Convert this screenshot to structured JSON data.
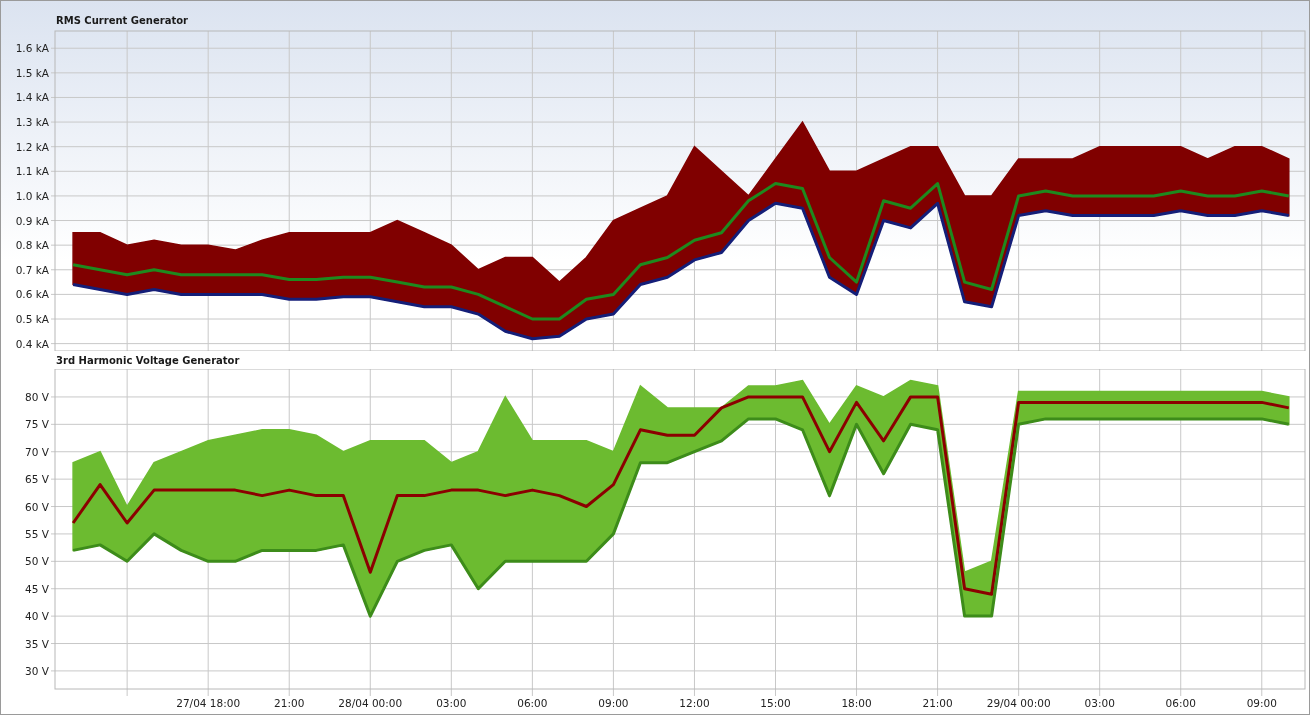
{
  "charts": [
    {
      "title": "RMS Current Generator",
      "chart_data": {
        "type": "line",
        "grid": true,
        "ylim": [
          0.37,
          1.67
        ],
        "yticks": [
          {
            "value": 0.4,
            "label": "0.4 kA"
          },
          {
            "value": 0.5,
            "label": "0.5 kA"
          },
          {
            "value": 0.6,
            "label": "0.6 kA"
          },
          {
            "value": 0.7,
            "label": "0.7 kA"
          },
          {
            "value": 0.8,
            "label": "0.8 kA"
          },
          {
            "value": 0.9,
            "label": "0.9 kA"
          },
          {
            "value": 1.0,
            "label": "1.0 kA"
          },
          {
            "value": 1.1,
            "label": "1.1 kA"
          },
          {
            "value": 1.2,
            "label": "1.2 kA"
          },
          {
            "value": 1.3,
            "label": "1.3 kA"
          },
          {
            "value": 1.4,
            "label": "1.4 kA"
          },
          {
            "value": 1.5,
            "label": "1.5 kA"
          },
          {
            "value": 1.6,
            "label": "1.6 kA"
          }
        ],
        "categories": [
          null,
          null,
          null,
          null,
          null,
          null,
          null,
          null,
          null,
          null,
          null,
          null,
          null,
          null,
          null,
          null,
          null,
          null,
          null,
          null,
          null,
          null,
          null,
          null,
          null,
          null,
          null,
          null,
          null,
          null,
          null,
          null,
          null,
          null,
          null,
          null,
          null,
          null,
          null,
          null,
          null,
          null,
          null,
          null,
          null,
          null
        ],
        "series": [
          {
            "type": "area",
            "color": "#800000",
            "values": [
              0.85,
              0.85,
              0.8,
              0.82,
              0.8,
              0.8,
              0.78,
              0.82,
              0.85,
              0.85,
              0.85,
              0.85,
              0.9,
              0.85,
              0.8,
              0.7,
              0.75,
              0.75,
              0.65,
              0.75,
              0.9,
              0.95,
              1.0,
              1.2,
              1.1,
              1.0,
              1.15,
              1.3,
              1.1,
              1.1,
              1.15,
              1.2,
              1.2,
              1.0,
              1.0,
              1.15,
              1.15,
              1.15,
              1.2,
              1.2,
              1.2,
              1.2,
              1.15,
              1.2,
              1.2,
              1.15
            ]
          },
          {
            "type": "line",
            "color": "#1e8a1e",
            "values": [
              0.72,
              0.7,
              0.68,
              0.7,
              0.68,
              0.68,
              0.68,
              0.68,
              0.66,
              0.66,
              0.67,
              0.67,
              0.65,
              0.63,
              0.63,
              0.6,
              0.55,
              0.5,
              0.5,
              0.58,
              0.6,
              0.72,
              0.75,
              0.82,
              0.85,
              0.98,
              1.05,
              1.03,
              0.75,
              0.65,
              0.98,
              0.95,
              1.05,
              0.65,
              0.62,
              1.0,
              1.02,
              1.0,
              1.0,
              1.0,
              1.0,
              1.02,
              1.0,
              1.0,
              1.02,
              1.0
            ]
          },
          {
            "type": "line",
            "color": "#141e78",
            "values": [
              0.64,
              0.62,
              0.6,
              0.62,
              0.6,
              0.6,
              0.6,
              0.6,
              0.58,
              0.58,
              0.59,
              0.59,
              0.57,
              0.55,
              0.55,
              0.52,
              0.45,
              0.42,
              0.43,
              0.5,
              0.52,
              0.64,
              0.67,
              0.74,
              0.77,
              0.9,
              0.97,
              0.95,
              0.67,
              0.6,
              0.9,
              0.87,
              0.97,
              0.57,
              0.55,
              0.92,
              0.94,
              0.92,
              0.92,
              0.92,
              0.92,
              0.94,
              0.92,
              0.92,
              0.94,
              0.92
            ]
          }
        ]
      }
    },
    {
      "title": "3rd Harmonic Voltage Generator",
      "chart_data": {
        "type": "line",
        "grid": true,
        "ylim": [
          26.7,
          85.1
        ],
        "yticks": [
          {
            "value": 30,
            "label": "30 V"
          },
          {
            "value": 35,
            "label": "35 V"
          },
          {
            "value": 40,
            "label": "40 V"
          },
          {
            "value": 45,
            "label": "45 V"
          },
          {
            "value": 50,
            "label": "50 V"
          },
          {
            "value": 55,
            "label": "55 V"
          },
          {
            "value": 60,
            "label": "60 V"
          },
          {
            "value": 65,
            "label": "65 V"
          },
          {
            "value": 70,
            "label": "70 V"
          },
          {
            "value": 75,
            "label": "75 V"
          },
          {
            "value": 80,
            "label": "80 V"
          }
        ],
        "categories": [
          null,
          null,
          null,
          null,
          null,
          "27/04 18:00",
          null,
          null,
          "21:00",
          null,
          null,
          "28/04 00:00",
          null,
          null,
          "03:00",
          null,
          null,
          "06:00",
          null,
          null,
          "09:00",
          null,
          null,
          "12:00",
          null,
          null,
          "15:00",
          null,
          null,
          "18:00",
          null,
          null,
          "21:00",
          null,
          null,
          "29/04 00:00",
          null,
          null,
          "03:00",
          null,
          null,
          "06:00",
          null,
          null,
          "09:00",
          null
        ],
        "series": [
          {
            "type": "area",
            "color": "#6cbb30",
            "values": [
              68,
              70,
              60,
              68,
              70,
              72,
              73,
              74,
              74,
              73,
              70,
              72,
              72,
              72,
              68,
              70,
              80,
              72,
              72,
              72,
              70,
              82,
              78,
              78,
              78,
              82,
              82,
              83,
              75,
              82,
              80,
              83,
              82,
              48,
              50,
              81,
              81,
              81,
              81,
              81,
              81,
              81,
              81,
              81,
              81,
              80
            ]
          },
          {
            "type": "line",
            "color": "#8b0000",
            "values": [
              57,
              64,
              57,
              63,
              63,
              63,
              63,
              62,
              63,
              62,
              62,
              48,
              62,
              62,
              63,
              63,
              62,
              63,
              62,
              60,
              64,
              74,
              73,
              73,
              78,
              80,
              80,
              80,
              70,
              79,
              72,
              80,
              80,
              45,
              44,
              79,
              79,
              79,
              79,
              79,
              79,
              79,
              79,
              79,
              79,
              78
            ]
          },
          {
            "type": "line",
            "color": "#3d8c1a",
            "values": [
              52,
              53,
              50,
              55,
              52,
              50,
              50,
              52,
              52,
              52,
              53,
              40,
              50,
              52,
              53,
              45,
              50,
              50,
              50,
              50,
              55,
              68,
              68,
              70,
              72,
              76,
              76,
              74,
              62,
              75,
              66,
              75,
              74,
              40,
              40,
              75,
              76,
              76,
              76,
              76,
              76,
              76,
              76,
              76,
              76,
              75
            ]
          }
        ]
      }
    }
  ]
}
